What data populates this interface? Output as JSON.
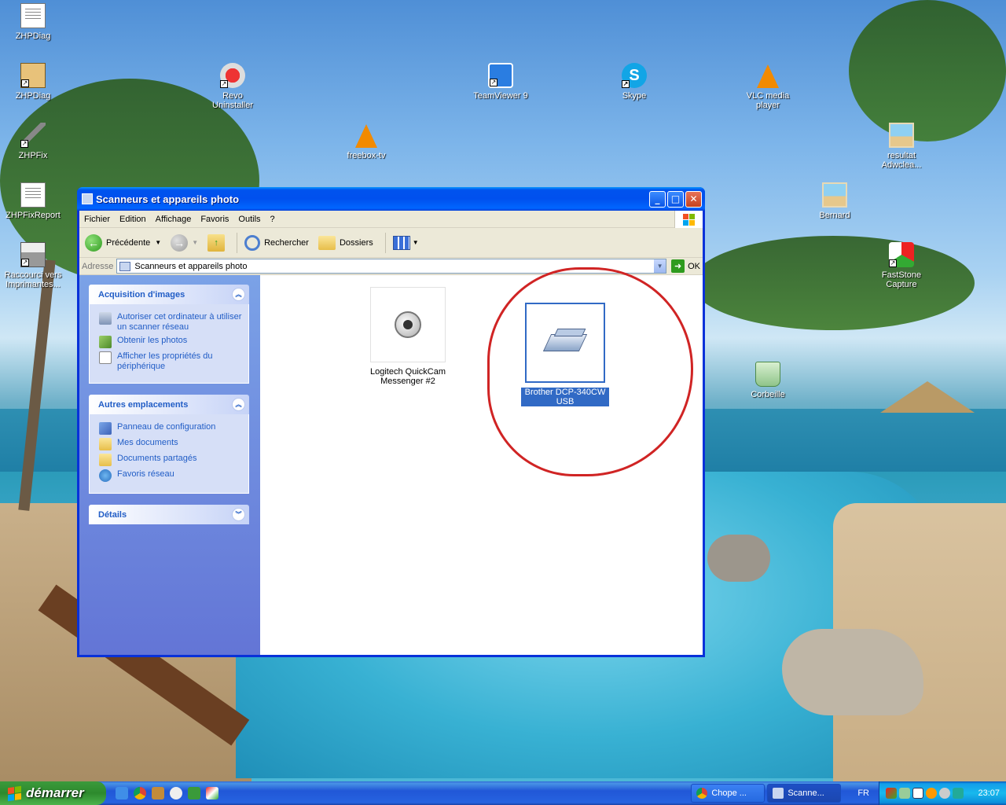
{
  "desktop": {
    "icons": [
      {
        "label": "ZHPDiag"
      },
      {
        "label": "ZHPDiag"
      },
      {
        "label": "ZHPFix"
      },
      {
        "label": "ZHPFixReport"
      },
      {
        "label": "Raccourci vers Imprimantes..."
      },
      {
        "label": "Revo Uninstaller"
      },
      {
        "label": "freebox-tv"
      },
      {
        "label": "TeamViewer 9"
      },
      {
        "label": "Skype"
      },
      {
        "label": "VLC media player"
      },
      {
        "label": "resultat Adwclea..."
      },
      {
        "label": "Bernard"
      },
      {
        "label": "FastStone Capture"
      },
      {
        "label": "Corbeille"
      }
    ]
  },
  "window": {
    "title": "Scanneurs et appareils photo",
    "menu": [
      "Fichier",
      "Edition",
      "Affichage",
      "Favoris",
      "Outils",
      "?"
    ],
    "toolbar": {
      "back": "Précédente",
      "search": "Rechercher",
      "folders": "Dossiers"
    },
    "address": {
      "label": "Adresse",
      "value": "Scanneurs et appareils photo",
      "go": "OK"
    },
    "panels": [
      {
        "title": "Acquisition d'images",
        "items": [
          "Autoriser cet ordinateur à utiliser un scanner réseau",
          "Obtenir les photos",
          "Afficher les propriétés du périphérique"
        ]
      },
      {
        "title": "Autres emplacements",
        "items": [
          "Panneau de configuration",
          "Mes documents",
          "Documents partagés",
          "Favoris réseau"
        ]
      },
      {
        "title": "Détails",
        "items": []
      }
    ],
    "files": [
      {
        "label": "Logitech QuickCam Messenger #2",
        "selected": false
      },
      {
        "label": "Brother DCP-340CW USB",
        "selected": true
      }
    ]
  },
  "taskbar": {
    "start": "démarrer",
    "tasks": [
      {
        "label": "Chope ..."
      },
      {
        "label": "Scanne..."
      }
    ],
    "lang": "FR",
    "clock": "23:07"
  },
  "colors": {
    "title_blue": "#0054e3",
    "panel_link": "#215dc6",
    "selection": "#316ac5",
    "annotation_red": "#d02424"
  }
}
